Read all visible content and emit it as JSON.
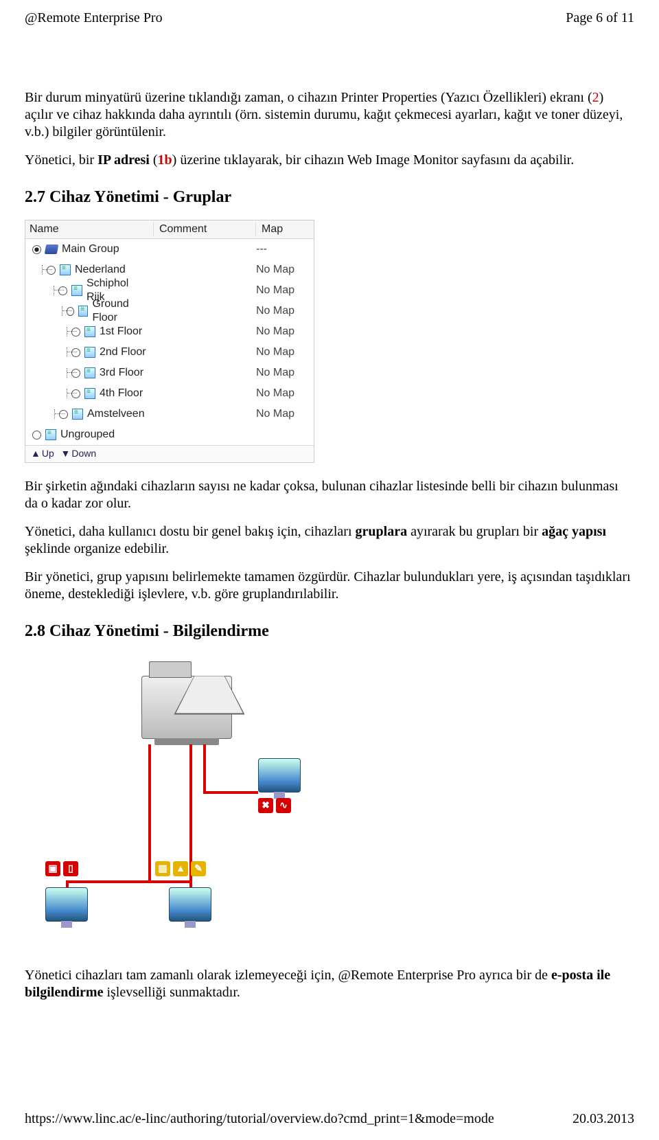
{
  "header": {
    "app": "@Remote Enterprise Pro",
    "pagelabel": "Page 6 of 11"
  },
  "footer": {
    "url": "https://www.linc.ac/e-linc/authoring/tutorial/overview.do?cmd_print=1&mode=mode",
    "date": "20.03.2013"
  },
  "para": {
    "p1a": "Bir durum minyatürü üzerine tıklandığı zaman, o cihazın Printer Properties (Yazıcı Özellikleri) ekranı (",
    "p1num": "2",
    "p1b": ") açılır ve cihaz hakkında daha ayrıntılı (örn. sistemin durumu, kağıt çekmecesi ayarları, kağıt ve toner düzeyi, v.b.) bilgiler görüntülenir.",
    "p2a": "Yönetici, bir ",
    "p2b": "IP adresi",
    "p2c": " (",
    "p2ref": "1b",
    "p2d": ") üzerine tıklayarak, bir cihazın Web Image Monitor sayfasını da açabilir.",
    "h27": "2.7 Cihaz Yönetimi - Gruplar",
    "p3": "Bir şirketin ağındaki cihazların sayısı ne kadar çoksa, bulunan cihazlar listesinde belli bir cihazın bulunması da o kadar zor olur.",
    "p4a": "Yönetici, daha kullanıcı dostu bir genel bakış için, cihazları ",
    "p4b": "gruplara",
    "p4c": " ayırarak bu grupları bir ",
    "p4d": "ağaç yapısı",
    "p4e": " şeklinde organize edebilir.",
    "p5": "Bir yönetici, grup yapısını belirlemekte tamamen özgürdür. Cihazlar bulundukları yere, iş açısından taşıdıkları öneme, desteklediği işlevlere, v.b. göre gruplandırılabilir.",
    "h28": "2.8 Cihaz Yönetimi - Bilgilendirme",
    "p6a": "Yönetici cihazları tam zamanlı olarak izlemeyeceği için, @Remote Enterprise Pro ayrıca bir de ",
    "p6b": "e-posta ile bilgilendirme",
    "p6c": " işlevselliği sunmaktadır."
  },
  "table": {
    "head": {
      "c1": "Name",
      "c2": "Comment",
      "c3": "Map"
    },
    "rows": [
      {
        "indent": 0,
        "sel": true,
        "icon": "folder",
        "name": "Main Group",
        "comment": "",
        "map": "---"
      },
      {
        "indent": 1,
        "sel": false,
        "icon": "tree",
        "name": "Nederland",
        "comment": "",
        "map": "No Map"
      },
      {
        "indent": 2,
        "sel": false,
        "icon": "tree",
        "name": "Schiphol Rijk",
        "comment": "",
        "map": "No Map"
      },
      {
        "indent": 3,
        "sel": false,
        "icon": "tree",
        "name": "Ground Floor",
        "comment": "",
        "map": "No Map"
      },
      {
        "indent": 3,
        "sel": false,
        "icon": "tree",
        "name": "1st Floor",
        "comment": "",
        "map": "No Map"
      },
      {
        "indent": 3,
        "sel": false,
        "icon": "tree",
        "name": "2nd Floor",
        "comment": "",
        "map": "No Map"
      },
      {
        "indent": 3,
        "sel": false,
        "icon": "tree",
        "name": "3rd Floor",
        "comment": "",
        "map": "No Map"
      },
      {
        "indent": 3,
        "sel": false,
        "icon": "tree",
        "name": "4th Floor",
        "comment": "",
        "map": "No Map"
      },
      {
        "indent": 2,
        "sel": false,
        "icon": "tree",
        "name": "Amstelveen",
        "comment": "",
        "map": "No Map"
      },
      {
        "indent": 0,
        "sel": false,
        "icon": "tree",
        "name": "Ungrouped",
        "comment": "",
        "map": ""
      }
    ],
    "foot": {
      "up": "Up",
      "down": "Down"
    }
  }
}
